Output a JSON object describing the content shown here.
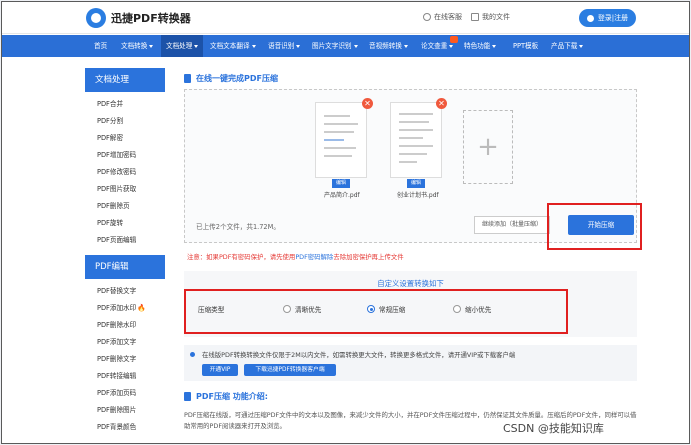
{
  "topbar": {
    "logo_text": "迅捷PDF转换器",
    "online_service": "在线客服",
    "my_files": "我的文件",
    "login": "登录|注册"
  },
  "nav": {
    "items": [
      {
        "label": "首页",
        "caret": false
      },
      {
        "label": "文档转换",
        "caret": true
      },
      {
        "label": "文档处理",
        "caret": true
      },
      {
        "label": "文档文本翻译",
        "caret": true
      },
      {
        "label": "语音识别",
        "caret": true
      },
      {
        "label": "图片文字识别",
        "caret": true
      },
      {
        "label": "音视频转换",
        "caret": true
      },
      {
        "label": "论文查重",
        "caret": true
      },
      {
        "label": "特色功能",
        "caret": true
      },
      {
        "label": "PPT模板",
        "caret": false
      },
      {
        "label": "产品下载",
        "caret": true
      }
    ]
  },
  "sidebar": {
    "section1": "文档处理",
    "items1": [
      "PDF合并",
      "PDF分割",
      "PDF解密",
      "PDF增加密码",
      "PDF修改密码",
      "PDF图片获取",
      "PDF删除页",
      "PDF旋转",
      "PDF页面编辑"
    ],
    "section2": "PDF编辑",
    "items2": [
      "PDF替换文字",
      "PDF添加水印",
      "PDF删除水印",
      "PDF添加文字",
      "PDF删除文字",
      "PDF转接编辑",
      "PDF添加页码",
      "PDF删除图片",
      "PDF背景颜色"
    ]
  },
  "main": {
    "title": "在线一键完成PDF压缩",
    "files": [
      {
        "name": "产品简介.pdf",
        "edit": "编辑"
      },
      {
        "name": "创业计划书.pdf",
        "edit": "编辑"
      }
    ],
    "files_info": "已上传2个文件，共1.72M。",
    "continue_btn": "继续添加（批量压缩）",
    "compress_btn": "开始压缩",
    "notice_prefix": "注意：如果PDF有密码保护，请先使用",
    "notice_link": "PDF密码解除",
    "notice_suffix": "去除加密保护再上传文件",
    "settings_title": "自定义设置转换如下",
    "option_label": "压缩类型",
    "options": [
      "清晰优先",
      "常规压缩",
      "缩小优先"
    ],
    "vip_text": "在线版PDF转换转换文件仅限于2M以内文件，如需转换更大文件，转换更多格式文件，请开通VIP或下载客户端",
    "vip_btn1": "开通VIP",
    "vip_btn2": "下载迅捷PDF转换器客户端",
    "func_title": "PDF压缩 功能介绍:",
    "func_desc": "PDF压缩在线版，可通过压缩PDF文件中的文本以及图像，来减少文件的大小，并在PDF文件压缩过程中，仍然保证其文件质量。压缩后的PDF文件，同样可以借助常用的PDF阅读器来打开及浏览。"
  },
  "watermark": "CSDN @技能知识库"
}
